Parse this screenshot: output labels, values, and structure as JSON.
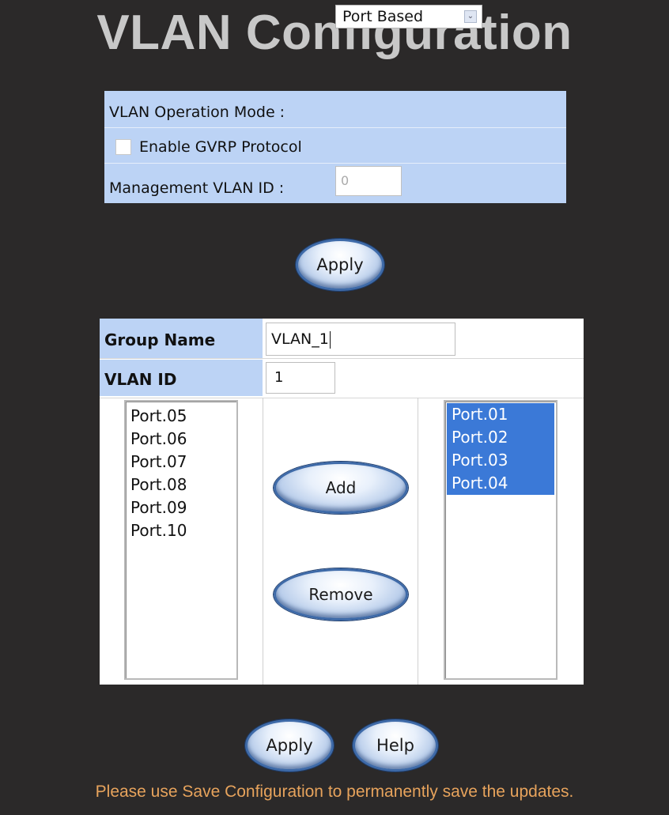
{
  "page": {
    "title": "VLAN Configuration"
  },
  "settings": {
    "mode_label": "VLAN Operation Mode :",
    "mode_value": "Port Based",
    "gvrp_label": "Enable GVRP Protocol",
    "gvrp_checked": false,
    "mgmt_label": "Management VLAN ID :",
    "mgmt_value": "0"
  },
  "buttons": {
    "apply_top": "Apply",
    "add": "Add",
    "remove": "Remove",
    "apply_bottom": "Apply",
    "help": "Help"
  },
  "group": {
    "name_label": "Group Name",
    "name_value": "VLAN_1",
    "id_label": "VLAN ID",
    "id_value": "1",
    "available_ports": [
      "Port.05",
      "Port.06",
      "Port.07",
      "Port.08",
      "Port.09",
      "Port.10"
    ],
    "member_ports": [
      "Port.01",
      "Port.02",
      "Port.03",
      "Port.04"
    ]
  },
  "footer": {
    "message": "Please use Save Configuration to permanently save the updates."
  },
  "colors": {
    "background": "#2b2929",
    "title": "#c8c8c8",
    "label_cell": "#bcd3f5",
    "selection": "#3b79d7",
    "footer_text": "#e7a35c"
  }
}
